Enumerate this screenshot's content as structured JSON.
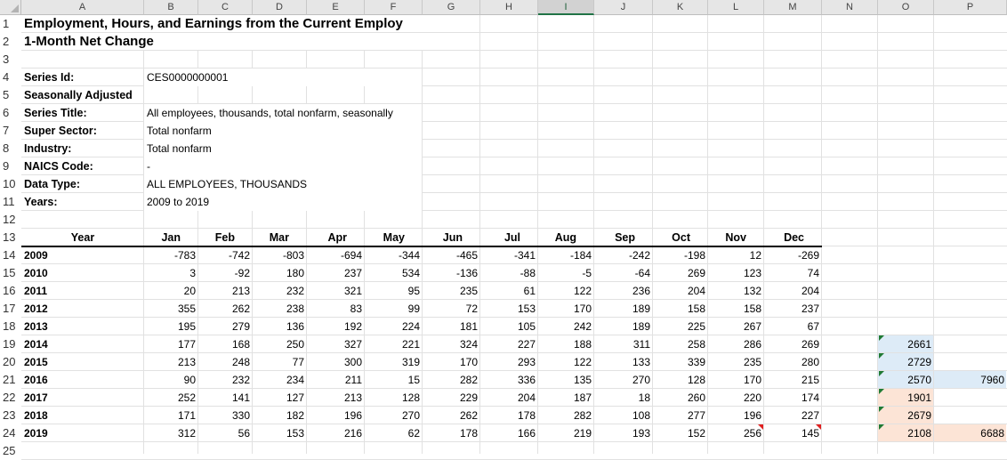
{
  "columns": [
    "A",
    "B",
    "C",
    "D",
    "E",
    "F",
    "G",
    "H",
    "I",
    "J",
    "K",
    "L",
    "M",
    "N",
    "O",
    "P"
  ],
  "selected_column": "I",
  "rows": [
    "1",
    "2",
    "3",
    "4",
    "5",
    "6",
    "7",
    "8",
    "9",
    "10",
    "11",
    "12",
    "13",
    "14",
    "15",
    "16",
    "17",
    "18",
    "19",
    "20",
    "21",
    "22",
    "23",
    "24",
    "25"
  ],
  "title1": "Employment, Hours, and Earnings from the Current Employ",
  "title2": "1-Month Net Change",
  "meta": [
    {
      "label": "Series Id:",
      "value": "CES0000000001"
    },
    {
      "label": "Seasonally Adjusted",
      "value": ""
    },
    {
      "label": "Series Title:",
      "value": "All employees, thousands, total nonfarm, seasonally"
    },
    {
      "label": "Super Sector:",
      "value": "Total nonfarm"
    },
    {
      "label": "Industry:",
      "value": "Total nonfarm"
    },
    {
      "label": "NAICS Code:",
      "value": "-"
    },
    {
      "label": "Data Type:",
      "value": "ALL EMPLOYEES, THOUSANDS"
    },
    {
      "label": "Years:",
      "value": "2009 to 2019"
    }
  ],
  "table_headers": [
    "Year",
    "Jan",
    "Feb",
    "Mar",
    "Apr",
    "May",
    "Jun",
    "Jul",
    "Aug",
    "Sep",
    "Oct",
    "Nov",
    "Dec"
  ],
  "table_rows": [
    [
      "2009",
      "-783",
      "-742",
      "-803",
      "-694",
      "-344",
      "-465",
      "-341",
      "-184",
      "-242",
      "-198",
      "12",
      "-269"
    ],
    [
      "2010",
      "3",
      "-92",
      "180",
      "237",
      "534",
      "-136",
      "-88",
      "-5",
      "-64",
      "269",
      "123",
      "74"
    ],
    [
      "2011",
      "20",
      "213",
      "232",
      "321",
      "95",
      "235",
      "61",
      "122",
      "236",
      "204",
      "132",
      "204"
    ],
    [
      "2012",
      "355",
      "262",
      "238",
      "83",
      "99",
      "72",
      "153",
      "170",
      "189",
      "158",
      "158",
      "237"
    ],
    [
      "2013",
      "195",
      "279",
      "136",
      "192",
      "224",
      "181",
      "105",
      "242",
      "189",
      "225",
      "267",
      "67"
    ],
    [
      "2014",
      "177",
      "168",
      "250",
      "327",
      "221",
      "324",
      "227",
      "188",
      "311",
      "258",
      "286",
      "269"
    ],
    [
      "2015",
      "213",
      "248",
      "77",
      "300",
      "319",
      "170",
      "293",
      "122",
      "133",
      "339",
      "235",
      "280"
    ],
    [
      "2016",
      "90",
      "232",
      "234",
      "211",
      "15",
      "282",
      "336",
      "135",
      "270",
      "128",
      "170",
      "215"
    ],
    [
      "2017",
      "252",
      "141",
      "127",
      "213",
      "128",
      "229",
      "204",
      "187",
      "18",
      "260",
      "220",
      "174"
    ],
    [
      "2018",
      "171",
      "330",
      "182",
      "196",
      "270",
      "262",
      "178",
      "282",
      "108",
      "277",
      "196",
      "227"
    ],
    [
      "2019",
      "312",
      "56",
      "153",
      "216",
      "62",
      "178",
      "166",
      "219",
      "193",
      "152",
      "256",
      "145"
    ]
  ],
  "side_values": {
    "O19": "2661",
    "O20": "2729",
    "O21": "2570",
    "O22": "1901",
    "O23": "2679",
    "O24": "2108",
    "P21": "7960",
    "P24": "6688"
  },
  "colors": {
    "blue_fill": "#ddebf7",
    "peach_fill": "#fce4d6",
    "green_marker": "#1f7a33",
    "red_marker": "#e02020"
  }
}
